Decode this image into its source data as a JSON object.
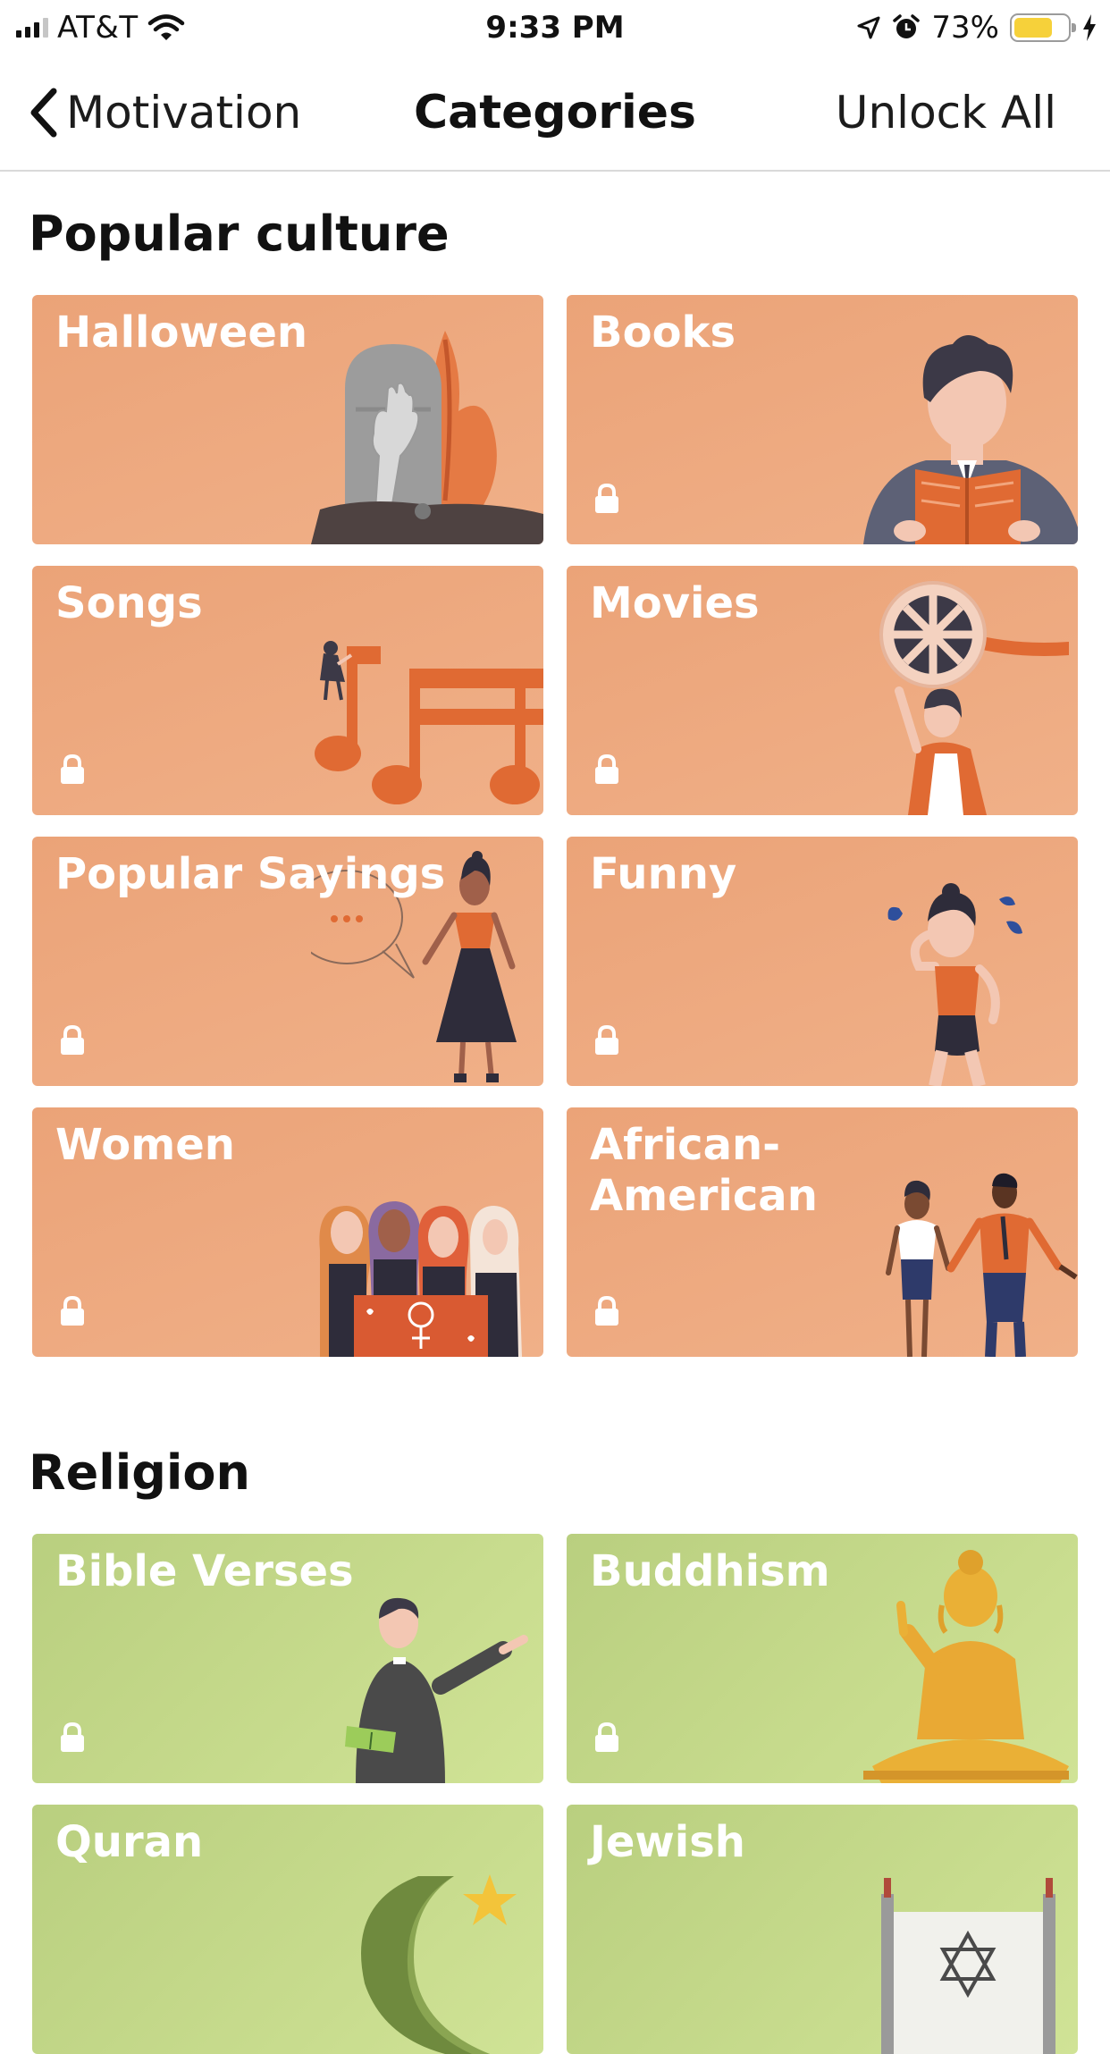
{
  "status_bar": {
    "carrier": "AT&T",
    "time": "9:33 PM",
    "battery_percent": "73%",
    "battery_level": 0.73,
    "signal_bars": 3,
    "icons": [
      "cellular-signal-icon",
      "wifi-icon",
      "location-arrow-icon",
      "alarm-icon",
      "battery-icon",
      "charging-bolt-icon"
    ]
  },
  "nav": {
    "back_label": "Motivation",
    "title": "Categories",
    "action_label": "Unlock All"
  },
  "sections": [
    {
      "title": "Popular culture",
      "color": "#EBA378",
      "cards": [
        {
          "label": "Halloween",
          "locked": false
        },
        {
          "label": "Books",
          "locked": true
        },
        {
          "label": "Songs",
          "locked": true
        },
        {
          "label": "Movies",
          "locked": true
        },
        {
          "label": "Popular Sayings",
          "locked": true
        },
        {
          "label": "Funny",
          "locked": true
        },
        {
          "label": "Women",
          "locked": true
        },
        {
          "label": "African-\nAmerican",
          "locked": true
        }
      ]
    },
    {
      "title": "Religion",
      "color": "#B9CF7F",
      "cards": [
        {
          "label": "Bible Verses",
          "locked": true
        },
        {
          "label": "Buddhism",
          "locked": true
        },
        {
          "label": "Quran",
          "locked": false
        },
        {
          "label": "Jewish",
          "locked": false
        }
      ]
    }
  ]
}
